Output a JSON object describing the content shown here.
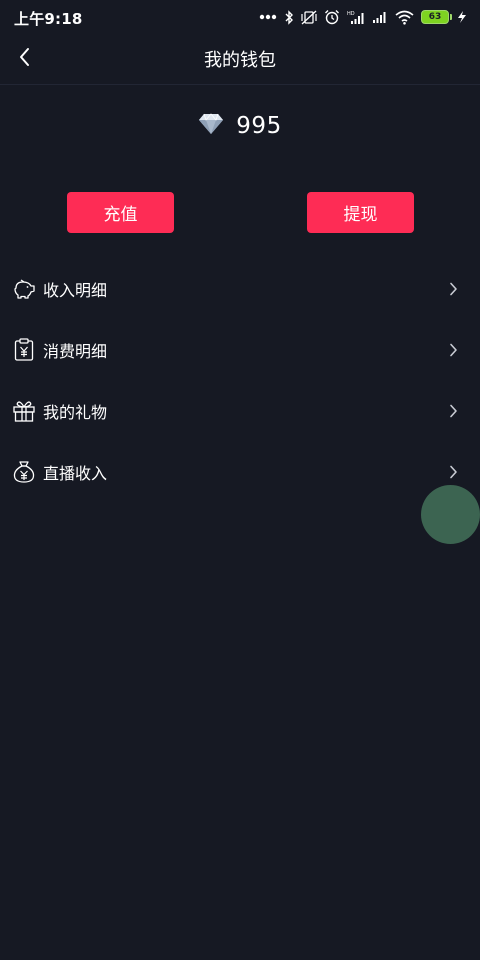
{
  "status_bar": {
    "time": "上午9:18",
    "battery_level": "63",
    "icons": [
      "more-dots-icon",
      "bluetooth-icon",
      "vibrate-icon",
      "alarm-icon",
      "hd-signal-icon",
      "signal-icon",
      "wifi-icon",
      "battery-icon",
      "charging-icon"
    ]
  },
  "nav": {
    "title": "我的钱包",
    "back_icon": "chevron-left-icon"
  },
  "balance": {
    "icon": "diamond-icon",
    "value": "995"
  },
  "actions": {
    "recharge_label": "充值",
    "withdraw_label": "提现"
  },
  "menu": {
    "items": [
      {
        "label": "收入明细",
        "icon": "piggy-bank-icon"
      },
      {
        "label": "消费明细",
        "icon": "receipt-yuan-icon"
      },
      {
        "label": "我的礼物",
        "icon": "gift-icon"
      },
      {
        "label": "直播收入",
        "icon": "money-bag-icon"
      }
    ]
  },
  "colors": {
    "background": "#161923",
    "accent": "#fe2c55",
    "text": "#ffffff",
    "battery": "#7ed321",
    "touch_indicator": "#3c6451"
  }
}
